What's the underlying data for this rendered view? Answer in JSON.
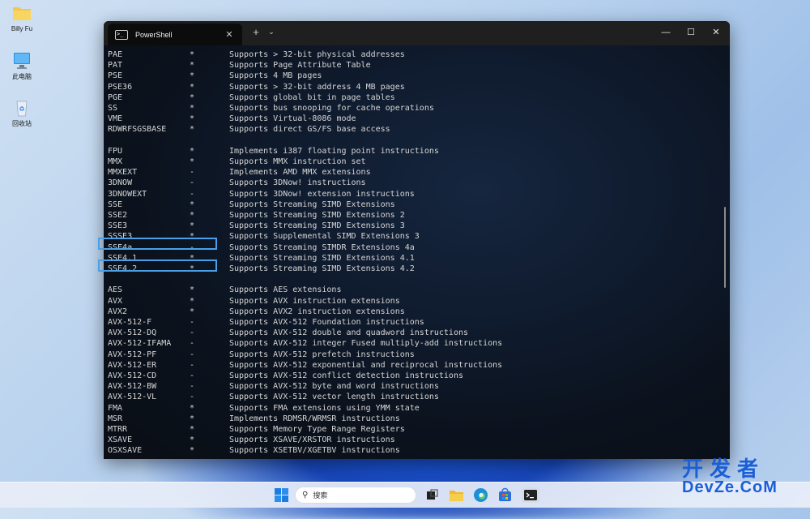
{
  "desktop": {
    "icons": [
      {
        "label": "Billy Fu",
        "icon": "folder-icon"
      },
      {
        "label": "此电脑",
        "icon": "computer-icon"
      },
      {
        "label": "回收站",
        "icon": "recycle-bin-icon"
      }
    ]
  },
  "window": {
    "tab_title": "PowerShell",
    "tab_close": "✕",
    "new_tab": "+",
    "dropdown": "⌄",
    "minimize": "—",
    "maximize": "☐",
    "close": "✕"
  },
  "terminal": {
    "lines": [
      {
        "name": "PAE",
        "flag": "*",
        "desc": "Supports > 32-bit physical addresses"
      },
      {
        "name": "PAT",
        "flag": "*",
        "desc": "Supports Page Attribute Table"
      },
      {
        "name": "PSE",
        "flag": "*",
        "desc": "Supports 4 MB pages"
      },
      {
        "name": "PSE36",
        "flag": "*",
        "desc": "Supports > 32-bit address 4 MB pages"
      },
      {
        "name": "PGE",
        "flag": "*",
        "desc": "Supports global bit in page tables"
      },
      {
        "name": "SS",
        "flag": "*",
        "desc": "Supports bus snooping for cache operations"
      },
      {
        "name": "VME",
        "flag": "*",
        "desc": "Supports Virtual-8086 mode"
      },
      {
        "name": "RDWRFSGSBASE",
        "flag": "*",
        "desc": "Supports direct GS/FS base access"
      },
      {
        "name": "",
        "flag": "",
        "desc": ""
      },
      {
        "name": "FPU",
        "flag": "*",
        "desc": "Implements i387 floating point instructions"
      },
      {
        "name": "MMX",
        "flag": "*",
        "desc": "Supports MMX instruction set"
      },
      {
        "name": "MMXEXT",
        "flag": "-",
        "desc": "Implements AMD MMX extensions"
      },
      {
        "name": "3DNOW",
        "flag": "-",
        "desc": "Supports 3DNow! instructions"
      },
      {
        "name": "3DNOWEXT",
        "flag": "-",
        "desc": "Supports 3DNow! extension instructions"
      },
      {
        "name": "SSE",
        "flag": "*",
        "desc": "Supports Streaming SIMD Extensions"
      },
      {
        "name": "SSE2",
        "flag": "*",
        "desc": "Supports Streaming SIMD Extensions 2"
      },
      {
        "name": "SSE3",
        "flag": "*",
        "desc": "Supports Streaming SIMD Extensions 3"
      },
      {
        "name": "SSSE3",
        "flag": "*",
        "desc": "Supports Supplemental SIMD Extensions 3"
      },
      {
        "name": "SSE4a",
        "flag": "-",
        "desc": "Supports Streaming SIMDR Extensions 4a"
      },
      {
        "name": "SSE4.1",
        "flag": "*",
        "desc": "Supports Streaming SIMD Extensions 4.1"
      },
      {
        "name": "SSE4.2",
        "flag": "*",
        "desc": "Supports Streaming SIMD Extensions 4.2"
      },
      {
        "name": "",
        "flag": "",
        "desc": ""
      },
      {
        "name": "AES",
        "flag": "*",
        "desc": "Supports AES extensions"
      },
      {
        "name": "AVX",
        "flag": "*",
        "desc": "Supports AVX instruction extensions"
      },
      {
        "name": "AVX2",
        "flag": "*",
        "desc": "Supports AVX2 instruction extensions"
      },
      {
        "name": "AVX-512-F",
        "flag": "-",
        "desc": "Supports AVX-512 Foundation instructions"
      },
      {
        "name": "AVX-512-DQ",
        "flag": "-",
        "desc": "Supports AVX-512 double and quadword instructions"
      },
      {
        "name": "AVX-512-IFAMA",
        "flag": "-",
        "desc": "Supports AVX-512 integer Fused multiply-add instructions"
      },
      {
        "name": "AVX-512-PF",
        "flag": "-",
        "desc": "Supports AVX-512 prefetch instructions"
      },
      {
        "name": "AVX-512-ER",
        "flag": "-",
        "desc": "Supports AVX-512 exponential and reciprocal instructions"
      },
      {
        "name": "AVX-512-CD",
        "flag": "-",
        "desc": "Supports AVX-512 conflict detection instructions"
      },
      {
        "name": "AVX-512-BW",
        "flag": "-",
        "desc": "Supports AVX-512 byte and word instructions"
      },
      {
        "name": "AVX-512-VL",
        "flag": "-",
        "desc": "Supports AVX-512 vector length instructions"
      },
      {
        "name": "FMA",
        "flag": "*",
        "desc": "Supports FMA extensions using YMM state"
      },
      {
        "name": "MSR",
        "flag": "*",
        "desc": "Implements RDMSR/WRMSR instructions"
      },
      {
        "name": "MTRR",
        "flag": "*",
        "desc": "Supports Memory Type Range Registers"
      },
      {
        "name": "XSAVE",
        "flag": "*",
        "desc": "Supports XSAVE/XRSTOR instructions"
      },
      {
        "name": "OSXSAVE",
        "flag": "*",
        "desc": "Supports XSETBV/XGETBV instructions"
      }
    ]
  },
  "taskbar": {
    "search_placeholder": "搜索",
    "items": [
      "windows-start-icon",
      "search-icon",
      "task-view-icon",
      "file-explorer-icon",
      "edge-browser-icon",
      "microsoft-store-icon",
      "terminal-icon"
    ]
  },
  "watermark": {
    "line1": "开发者",
    "line2": "DevZe.CoM"
  },
  "colors": {
    "highlight": "#4aa0e8",
    "terminal_text": "#d6d6d6"
  }
}
